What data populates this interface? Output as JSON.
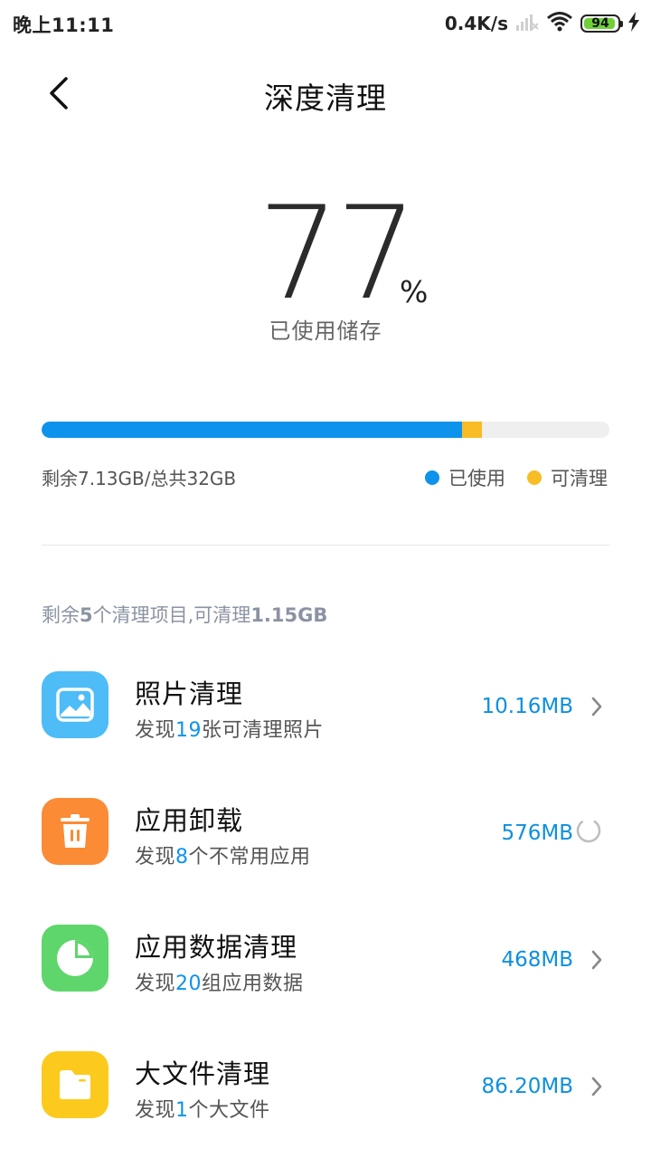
{
  "status_bar": {
    "time": "晚上11:11",
    "net_speed": "0.4K/s",
    "battery": "94"
  },
  "header": {
    "title": "深度清理",
    "back_icon": "chevron-left-icon"
  },
  "usage": {
    "percent": "77",
    "unit": "%",
    "label": "已使用储存",
    "used_fraction": 0.74,
    "cleanable_fraction": 0.036
  },
  "storage": {
    "summary": "剩余7.13GB/总共32GB",
    "legend": [
      {
        "label": "已使用",
        "color": "#0d93ec"
      },
      {
        "label": "可清理",
        "color": "#f8bc24"
      }
    ]
  },
  "section": {
    "prefix": "剩余",
    "count": "5",
    "middle": "个清理项目,可清理",
    "total": "1.15GB"
  },
  "items": [
    {
      "title": "照片清理",
      "sub_prefix": "发现",
      "sub_count": "19",
      "sub_suffix": "张可清理照片",
      "size": "10.16MB",
      "icon": "photo-icon",
      "color": "#4dbcf7",
      "status": "chevron"
    },
    {
      "title": "应用卸载",
      "sub_prefix": "发现",
      "sub_count": "8",
      "sub_suffix": "个不常用应用",
      "size": "576MB",
      "icon": "trash-icon",
      "color": "#fb8b35",
      "status": "loading"
    },
    {
      "title": "应用数据清理",
      "sub_prefix": "发现",
      "sub_count": "20",
      "sub_suffix": "组应用数据",
      "size": "468MB",
      "icon": "pie-chart-icon",
      "color": "#5ed66b",
      "status": "chevron"
    },
    {
      "title": "大文件清理",
      "sub_prefix": "发现",
      "sub_count": "1",
      "sub_suffix": "个大文件",
      "size": "86.20MB",
      "icon": "folder-icon",
      "color": "#fcca1c",
      "status": "chevron"
    }
  ]
}
